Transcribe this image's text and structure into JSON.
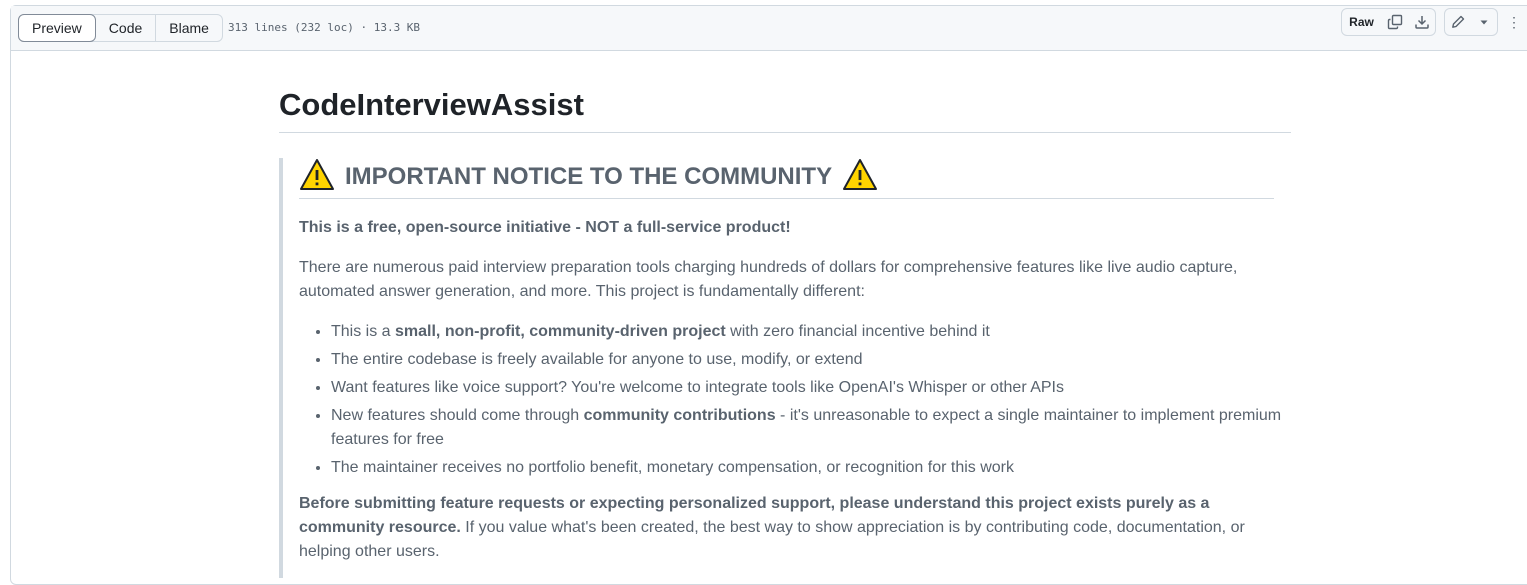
{
  "toolbar": {
    "tabs": [
      {
        "label": "Preview",
        "active": true
      },
      {
        "label": "Code",
        "active": false
      },
      {
        "label": "Blame",
        "active": false
      }
    ],
    "file_info": "313 lines (232 loc) · 13.3 KB",
    "raw_label": "Raw",
    "copy_icon": "copy-icon",
    "download_icon": "download-icon",
    "edit_icon": "pencil-icon",
    "more_icon": "kebab-icon"
  },
  "readme": {
    "title": "CodeInterviewAssist",
    "notice": {
      "heading": "IMPORTANT NOTICE TO THE COMMUNITY",
      "icon": "warning-icon",
      "lead": "This is a free, open-source initiative - NOT a full-service product!",
      "intro": "There are numerous paid interview preparation tools charging hundreds of dollars for comprehensive features like live audio capture, automated answer generation, and more. This project is fundamentally different:",
      "bullets": [
        {
          "before": "This is a ",
          "bold": "small, non-profit, community-driven project",
          "after": " with zero financial incentive behind it"
        },
        {
          "before": "The entire codebase is freely available for anyone to use, modify, or extend",
          "bold": "",
          "after": ""
        },
        {
          "before": "Want features like voice support? You're welcome to integrate tools like OpenAI's Whisper or other APIs",
          "bold": "",
          "after": ""
        },
        {
          "before": "New features should come through ",
          "bold": "community contributions",
          "after": " - it's unreasonable to expect a single maintainer to implement premium features for free"
        },
        {
          "before": "The maintainer receives no portfolio benefit, monetary compensation, or recognition for this work",
          "bold": "",
          "after": ""
        }
      ],
      "closing_bold": "Before submitting feature requests or expecting personalized support, please understand this project exists purely as a community resource.",
      "closing_rest": " If you value what's been created, the best way to show appreciation is by contributing code, documentation, or helping other users."
    }
  },
  "colors": {
    "border": "#d1d9e0",
    "muted_text": "#59636e",
    "warning_fill": "#ffd400"
  }
}
